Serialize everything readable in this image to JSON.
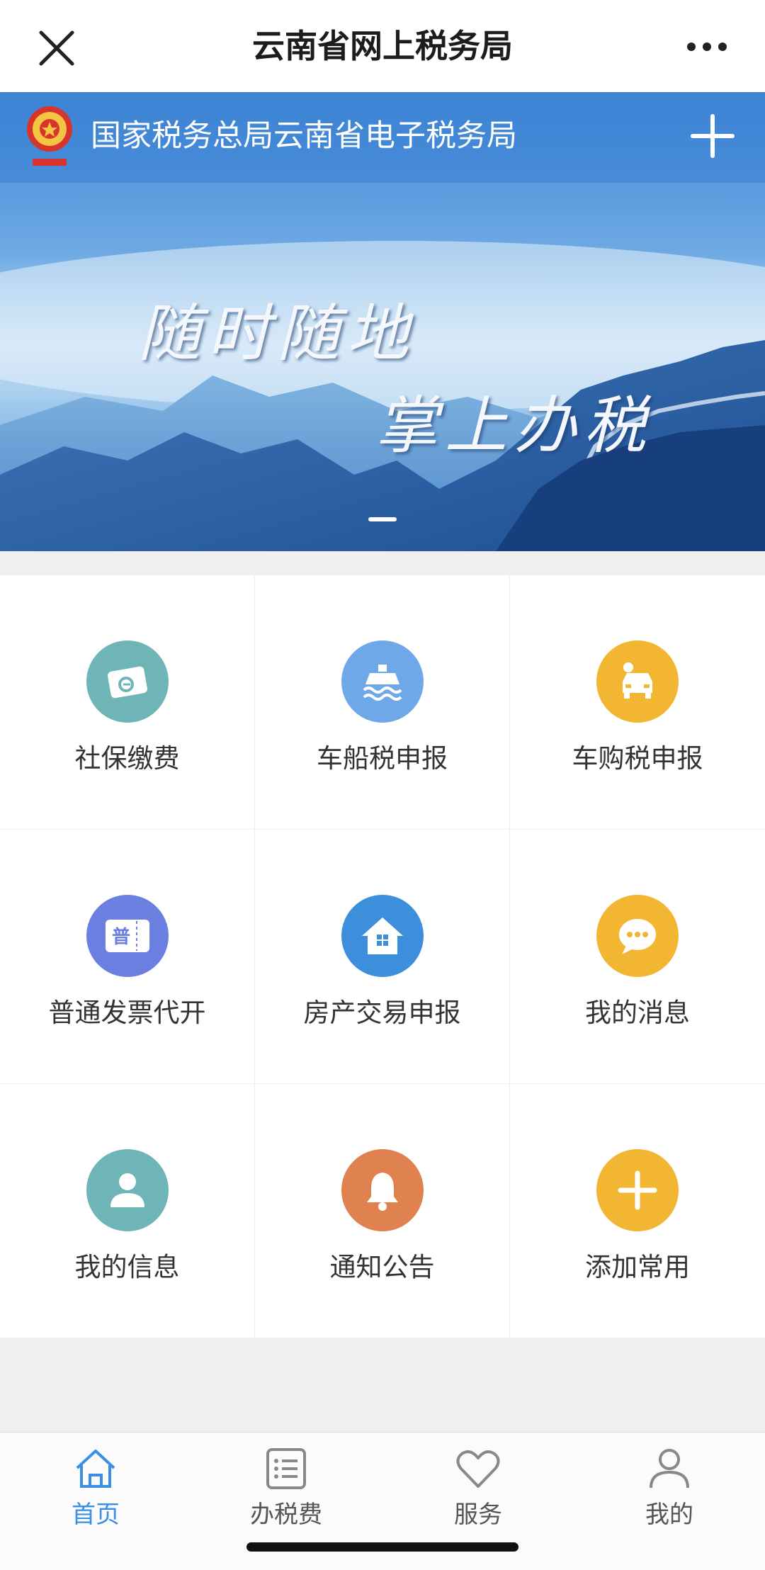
{
  "window": {
    "title": "云南省网上税务局"
  },
  "banner": {
    "brand": "国家税务总局云南省电子税务局",
    "slogan_line1": "随时随地",
    "slogan_line2": "掌上办税",
    "slide_count_visible": 1
  },
  "services": [
    {
      "label": "社保缴费",
      "icon": "social-security-card-icon",
      "color": "#6fb5b8"
    },
    {
      "label": "车船税申报",
      "icon": "ship-icon",
      "color": "#6fa8e8"
    },
    {
      "label": "车购税申报",
      "icon": "car-icon",
      "color": "#f2b632"
    },
    {
      "label": "普通发票代开",
      "icon": "invoice-icon",
      "color": "#6b7fe0"
    },
    {
      "label": "房产交易申报",
      "icon": "house-icon",
      "color": "#3d8fdc"
    },
    {
      "label": "我的消息",
      "icon": "chat-bubble-icon",
      "color": "#f2b632"
    },
    {
      "label": "我的信息",
      "icon": "user-icon",
      "color": "#6fb5b8"
    },
    {
      "label": "通知公告",
      "icon": "bell-icon",
      "color": "#e08250"
    },
    {
      "label": "添加常用",
      "icon": "plus-icon",
      "color": "#f2b632"
    }
  ],
  "invoice_icon_char": "普",
  "nav": [
    {
      "label": "首页",
      "icon": "home-icon",
      "active": true
    },
    {
      "label": "办税费",
      "icon": "list-icon",
      "active": false
    },
    {
      "label": "服务",
      "icon": "heart-icon",
      "active": false
    },
    {
      "label": "我的",
      "icon": "person-icon",
      "active": false
    }
  ],
  "colors": {
    "accent": "#3a8ee6",
    "banner_blue": "#3b82d4"
  }
}
